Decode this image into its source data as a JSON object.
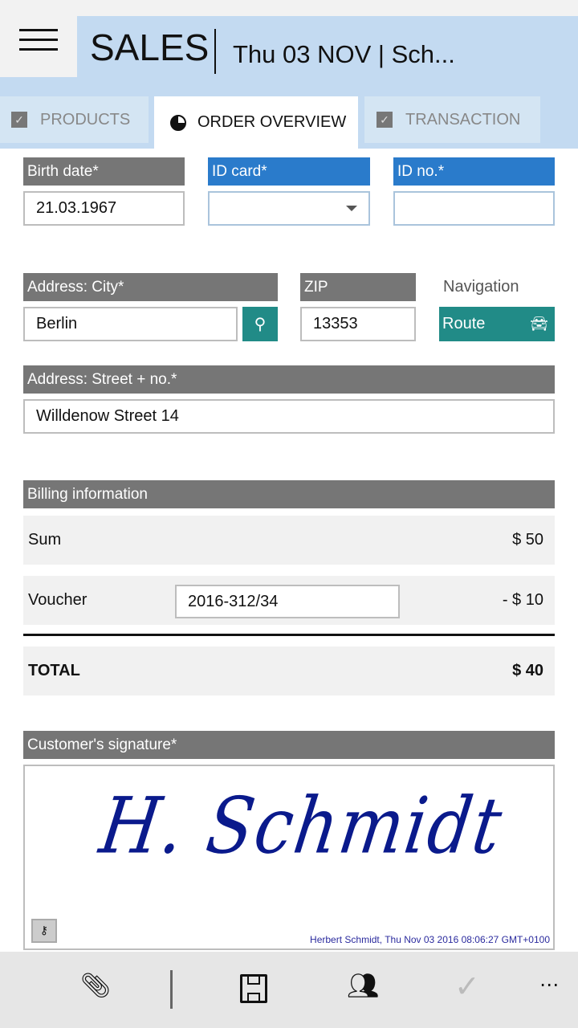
{
  "header": {
    "title": "SALES",
    "subtitle": "Thu 03 NOV | Sch..."
  },
  "tabs": [
    {
      "label": "PRODUCTS",
      "state": "checked"
    },
    {
      "label": "ORDER OVERVIEW",
      "state": "active"
    },
    {
      "label": "TRANSACTION",
      "state": "checked"
    }
  ],
  "form": {
    "birth_date": {
      "label": "Birth date*",
      "value": "21.03.1967"
    },
    "id_card": {
      "label": "ID card*",
      "value": ""
    },
    "id_no": {
      "label": "ID no.*",
      "value": ""
    },
    "city": {
      "label": "Address: City*",
      "value": "Berlin"
    },
    "zip": {
      "label": "ZIP",
      "value": "13353"
    },
    "navigation": {
      "label": "Navigation",
      "button": "Route"
    },
    "street": {
      "label": "Address: Street + no.*",
      "value": "Willdenow Street 14"
    }
  },
  "billing": {
    "label": "Billing information",
    "sum_label": "Sum",
    "sum": "$ 50",
    "voucher_label": "Voucher",
    "voucher_code": "2016-312/34",
    "voucher_value": "- $ 10",
    "total_label": "TOTAL",
    "total": "$ 40"
  },
  "signature": {
    "label": "Customer's signature*",
    "handwriting": "H. Schmidt",
    "stamp": "Herbert Schmidt, Thu Nov 03 2016 08:06:27 GMT+0100"
  },
  "colors": {
    "header": "#c3daf1",
    "label_gray": "#767676",
    "label_blue": "#2a7bcb",
    "teal": "#218b87",
    "signature_ink": "#0a1a8c"
  },
  "toolbar": {
    "icons": [
      "paperclip-icon",
      "save-icon",
      "people-icon",
      "check-icon",
      "more-icon"
    ]
  }
}
